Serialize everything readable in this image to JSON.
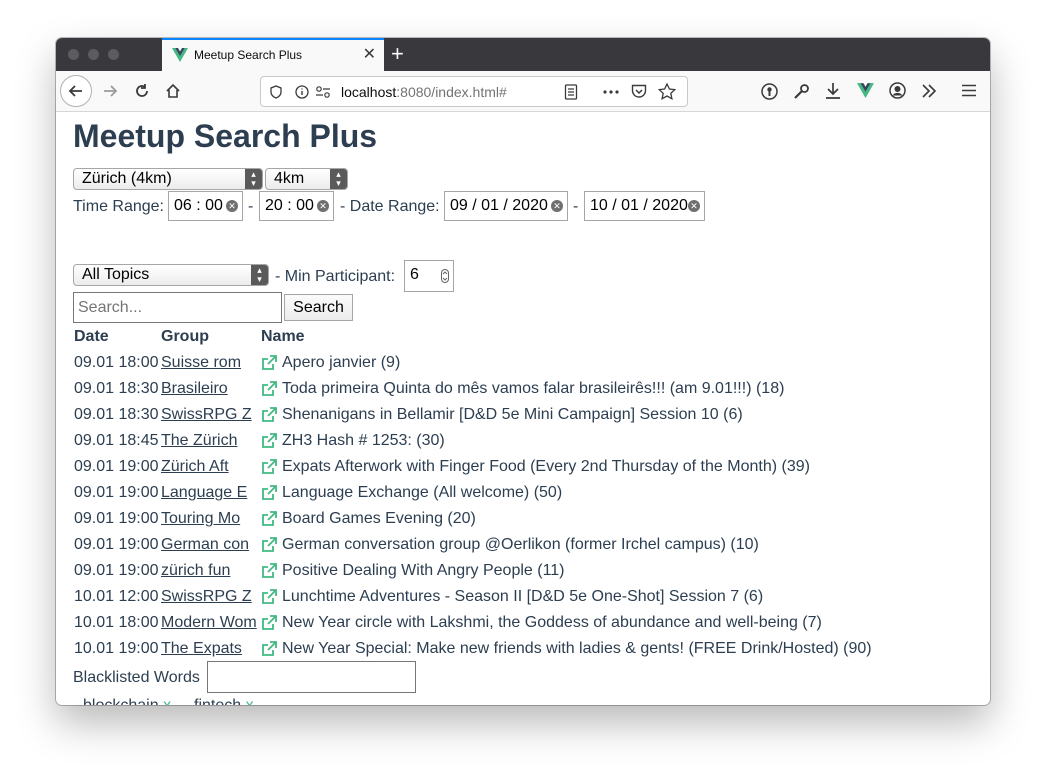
{
  "browser": {
    "tab_title": "Meetup Search Plus",
    "new_tab": "+",
    "tab_close": "✕",
    "url_host": "localhost",
    "url_rest": ":8080/index.html#"
  },
  "page": {
    "title": "Meetup Search Plus",
    "filters": {
      "location": "Zürich (4km)",
      "radius": "4km",
      "time_range_label": "Time Range:",
      "time_from": "06 : 00",
      "time_to": "20 : 00",
      "sep": "-",
      "date_range_label": "- Date Range:",
      "date_from": "09 / 01 / 2020",
      "date_to": "10 / 01 / 2020",
      "topic": "All Topics",
      "min_participant_label": "- Min Participant:",
      "min_participant": "6"
    },
    "search": {
      "placeholder": "Search...",
      "button": "Search"
    },
    "table": {
      "headers": [
        "Date",
        "Group",
        "Name"
      ],
      "rows": [
        {
          "date": "09.01 18:00",
          "group": "Suisse rom",
          "name": "Apero janvier (9)"
        },
        {
          "date": "09.01 18:30",
          "group": "Brasileiro",
          "name": "Toda primeira Quinta do mês vamos falar brasileirês!!! (am 9.01!!!) (18)"
        },
        {
          "date": "09.01 18:30",
          "group": "SwissRPG Z",
          "name": "Shenanigans in Bellamir [D&D 5e Mini Campaign] Session 10 (6)"
        },
        {
          "date": "09.01 18:45",
          "group": "The Zürich",
          "name": "ZH3 Hash # 1253: (30)"
        },
        {
          "date": "09.01 19:00",
          "group": "Zürich Aft",
          "name": "Expats Afterwork with Finger Food (Every 2nd Thursday of the Month) (39)"
        },
        {
          "date": "09.01 19:00",
          "group": "Language E",
          "name": "Language Exchange (All welcome) (50)"
        },
        {
          "date": "09.01 19:00",
          "group": "Touring Mo",
          "name": "Board Games Evening (20)"
        },
        {
          "date": "09.01 19:00",
          "group": "German con",
          "name": "German conversation group @Oerlikon (former Irchel campus) (10)"
        },
        {
          "date": "09.01 19:00",
          "group": "zürich fun",
          "name": "Positive Dealing With Angry People (11)"
        },
        {
          "date": "10.01 12:00",
          "group": "SwissRPG Z",
          "name": "Lunchtime Adventures - Season II [D&D 5e One-Shot] Session 7 (6)"
        },
        {
          "date": "10.01 18:00",
          "group": "Modern Wom",
          "name": "New Year circle with Lakshmi, the Goddess of abundance and well-being (7)"
        },
        {
          "date": "10.01 19:00",
          "group": "The Expats",
          "name": "New Year Special: Make new friends with ladies & gents! (FREE Drink/Hosted) (90)"
        }
      ]
    },
    "blacklist": {
      "label": "Blacklisted Words",
      "remove": "x",
      "words": [
        "blockchain",
        "fintech"
      ]
    }
  },
  "colors": {
    "heading": "#2c3e50",
    "accent": "#42b983",
    "tab_highlight": "#0a84ff"
  }
}
